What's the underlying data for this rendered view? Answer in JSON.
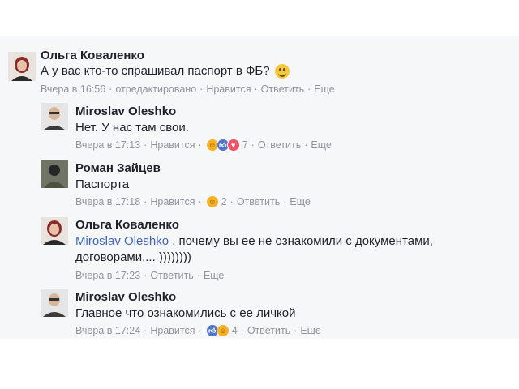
{
  "comments": [
    {
      "author": "Ольга Коваленко",
      "text": "А у вас кто-то спрашивал паспорт в ФБ?",
      "time": "Вчера в 16:56",
      "edited": "отредактировано",
      "like": "Нравится",
      "reply": "Ответить",
      "more": "Еще"
    },
    {
      "author": "Miroslav Oleshko",
      "text": "Нет. У нас там свои.",
      "time": "Вчера в 17:13",
      "like": "Нравится",
      "reactions_count": "7",
      "reactions": [
        "haha-icon",
        "like-icon",
        "love-icon"
      ],
      "reply": "Ответить",
      "more": "Еще"
    },
    {
      "author": "Роман Зайцев",
      "text": "Паспорта",
      "time": "Вчера в 17:18",
      "like": "Нравится",
      "reactions_count": "2",
      "reactions": [
        "haha-icon"
      ],
      "reply": "Ответить",
      "more": "Еще"
    },
    {
      "author": "Ольга Коваленко",
      "mention": "Miroslav Oleshko",
      "text_line1": " , почему вы ее не ознакомили с документами,",
      "text_line2": "договорами.... ))))))))",
      "time": "Вчера в 17:23",
      "reply": "Ответить",
      "more": "Еще"
    },
    {
      "author": "Miroslav Oleshko",
      "text": "Главное что ознакомились с ее личкой",
      "time": "Вчера в 17:24",
      "like": "Нравится",
      "reactions_count": "4",
      "reactions": [
        "like-icon",
        "haha-icon"
      ],
      "reply": "Ответить",
      "more": "Еще"
    }
  ],
  "colors": {
    "panel": "#f6f7f9",
    "name": "#1d2129",
    "meta": "#90949c",
    "mention": "#4267b2"
  }
}
